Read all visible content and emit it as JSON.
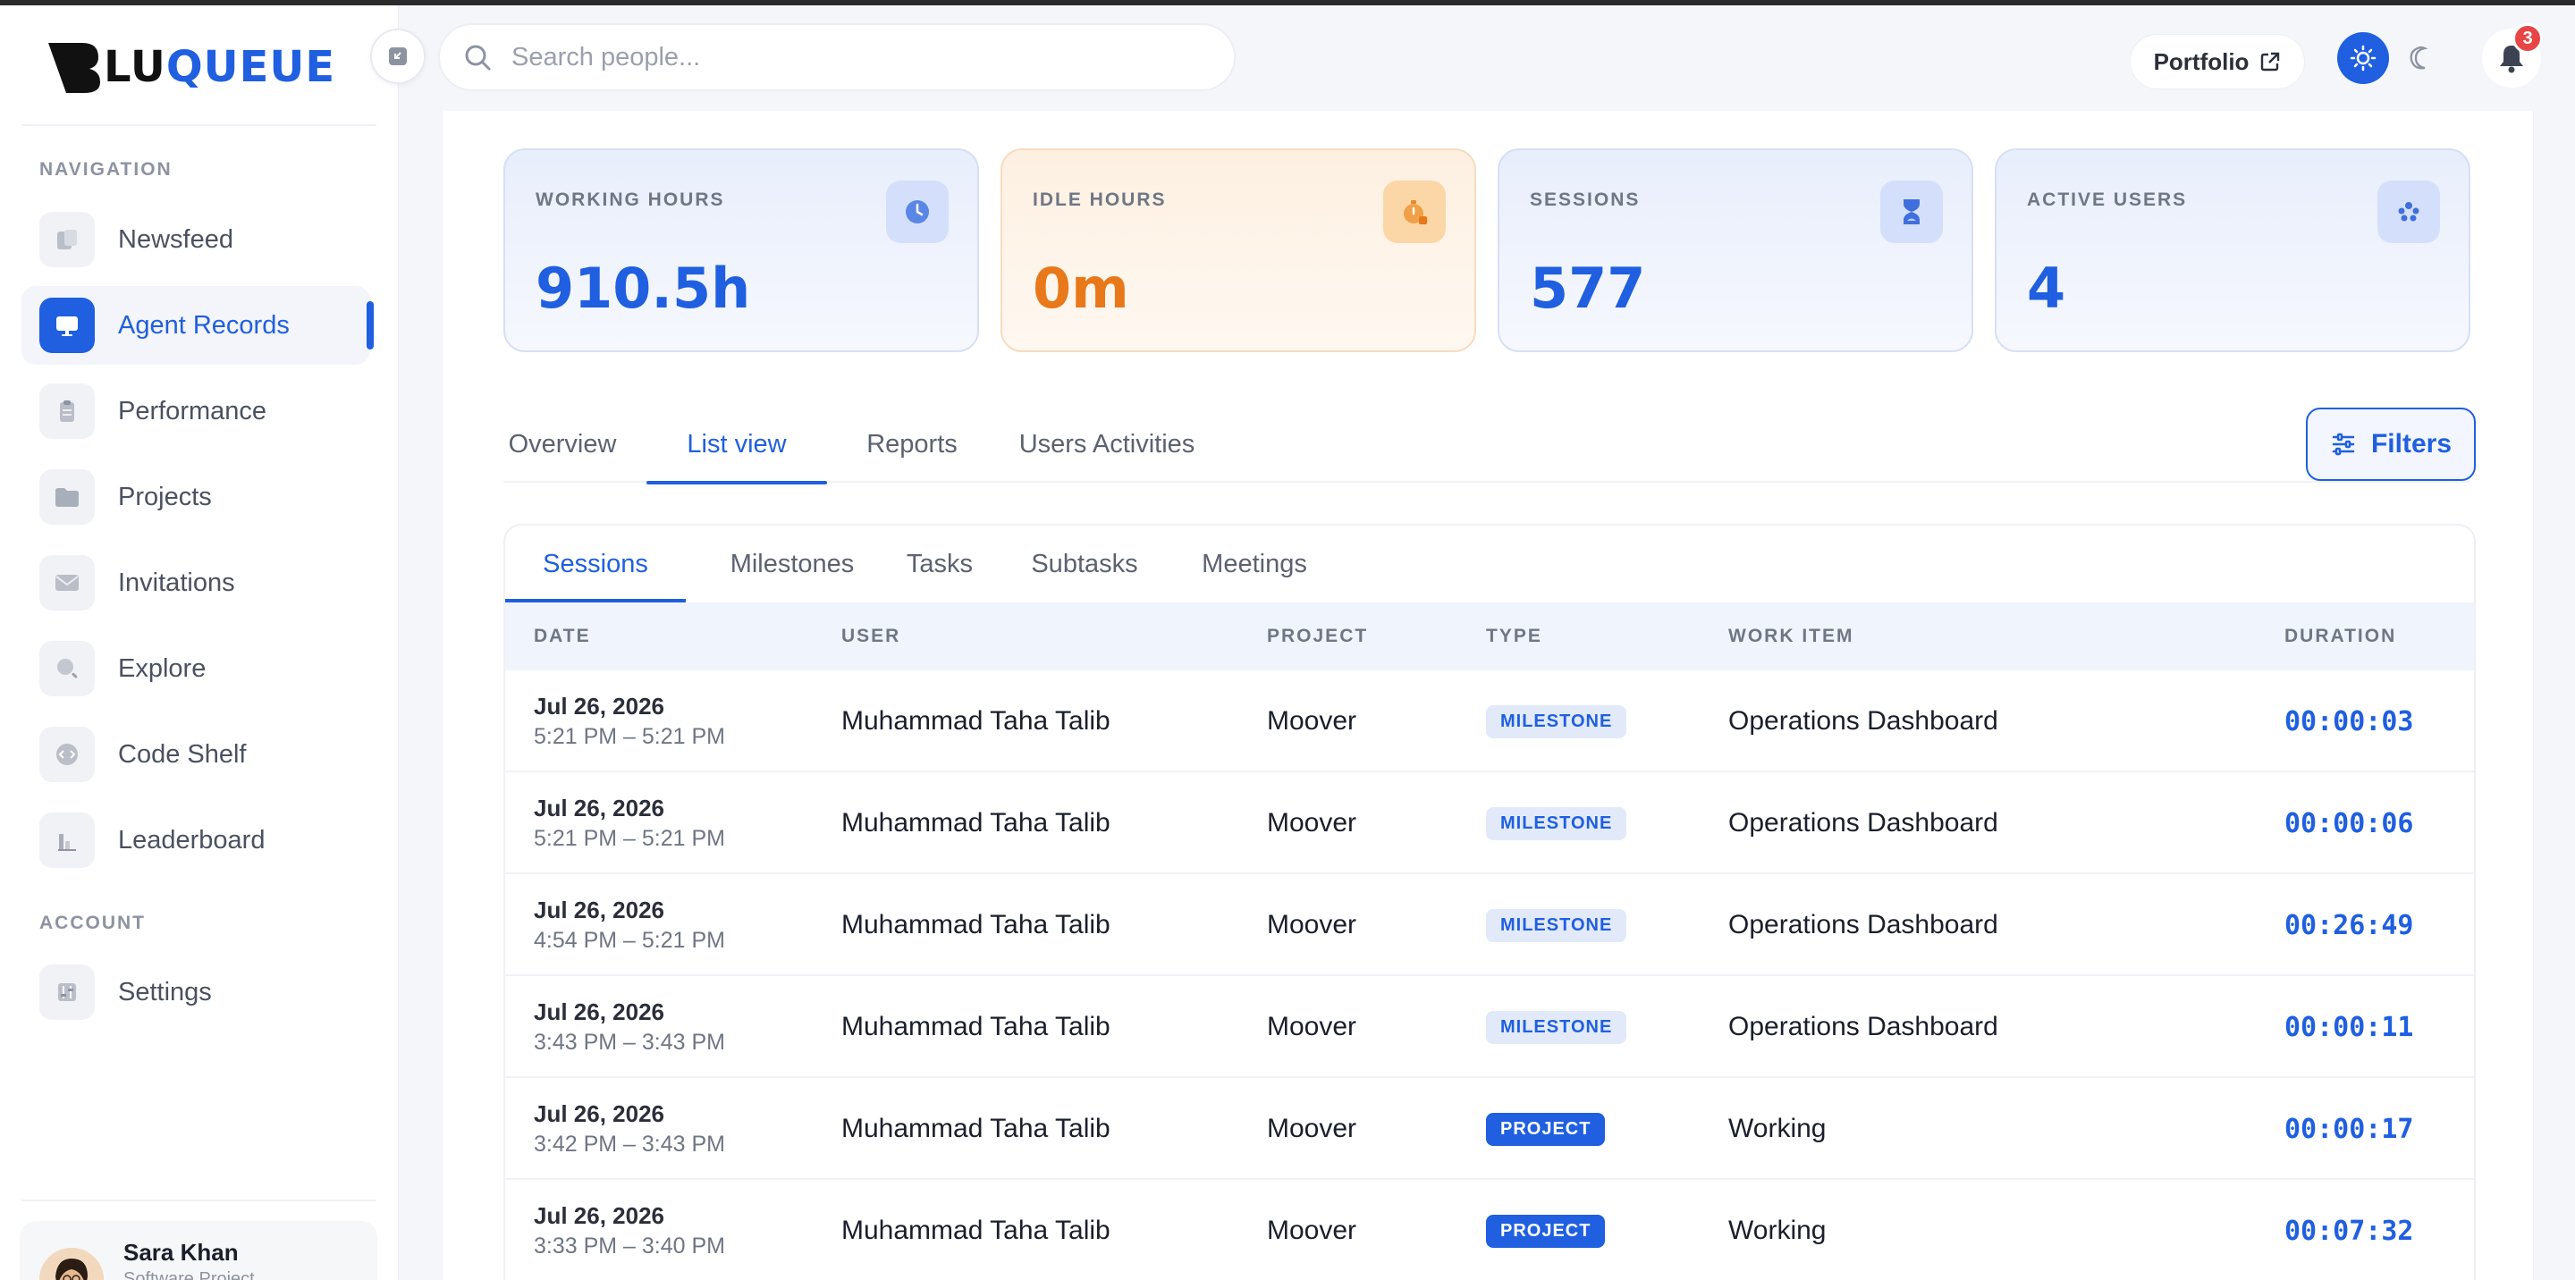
{
  "app": {
    "logo_part1": "LU",
    "logo_part2": "QUEUE",
    "accent_color": "#1f5fe0"
  },
  "search": {
    "placeholder": "Search people..."
  },
  "header": {
    "portfolio_label": "Portfolio",
    "notifications_count": "3"
  },
  "sidebar": {
    "nav_title": "NAVIGATION",
    "account_title": "ACCOUNT",
    "items": [
      {
        "label": "Newsfeed",
        "icon": "newsfeed-icon"
      },
      {
        "label": "Agent Records",
        "icon": "monitor-icon",
        "active": true
      },
      {
        "label": "Performance",
        "icon": "clipboard-icon"
      },
      {
        "label": "Projects",
        "icon": "folder-icon"
      },
      {
        "label": "Invitations",
        "icon": "envelope-icon"
      },
      {
        "label": "Explore",
        "icon": "search-icon"
      },
      {
        "label": "Code Shelf",
        "icon": "code-icon"
      },
      {
        "label": "Leaderboard",
        "icon": "bar-chart-icon"
      }
    ],
    "account_items": [
      {
        "label": "Settings",
        "icon": "sliders-icon"
      }
    ],
    "profile": {
      "name": "Sara Khan",
      "subtitle": "Software Project"
    }
  },
  "stats": [
    {
      "label": "WORKING HOURS",
      "value": "910.5h",
      "icon": "clock-icon"
    },
    {
      "label": "IDLE HOURS",
      "value": "0m",
      "icon": "timer-icon"
    },
    {
      "label": "SESSIONS",
      "value": "577",
      "icon": "hourglass-icon"
    },
    {
      "label": "ACTIVE USERS",
      "value": "4",
      "icon": "users-icon"
    }
  ],
  "tabs": [
    "Overview",
    "List view",
    "Reports",
    "Users Activities"
  ],
  "active_tab": "List view",
  "filters_label": "Filters",
  "subtabs": [
    "Sessions",
    "Milestones",
    "Tasks",
    "Subtasks",
    "Meetings"
  ],
  "active_subtab": "Sessions",
  "table": {
    "columns": [
      "DATE",
      "USER",
      "PROJECT",
      "TYPE",
      "WORK ITEM",
      "DURATION"
    ],
    "rows": [
      {
        "date": "Jul 26, 2026",
        "time": "5:21 PM – 5:21 PM",
        "user": "Muhammad Taha Talib",
        "project": "Moover",
        "type": "MILESTONE",
        "work_item": "Operations Dashboard",
        "duration": "00:00:03"
      },
      {
        "date": "Jul 26, 2026",
        "time": "5:21 PM – 5:21 PM",
        "user": "Muhammad Taha Talib",
        "project": "Moover",
        "type": "MILESTONE",
        "work_item": "Operations Dashboard",
        "duration": "00:00:06"
      },
      {
        "date": "Jul 26, 2026",
        "time": "4:54 PM – 5:21 PM",
        "user": "Muhammad Taha Talib",
        "project": "Moover",
        "type": "MILESTONE",
        "work_item": "Operations Dashboard",
        "duration": "00:26:49"
      },
      {
        "date": "Jul 26, 2026",
        "time": "3:43 PM – 3:43 PM",
        "user": "Muhammad Taha Talib",
        "project": "Moover",
        "type": "MILESTONE",
        "work_item": "Operations Dashboard",
        "duration": "00:00:11"
      },
      {
        "date": "Jul 26, 2026",
        "time": "3:42 PM – 3:43 PM",
        "user": "Muhammad Taha Talib",
        "project": "Moover",
        "type": "PROJECT",
        "work_item": "Working",
        "duration": "00:00:17"
      },
      {
        "date": "Jul 26, 2026",
        "time": "3:33 PM – 3:40 PM",
        "user": "Muhammad Taha Talib",
        "project": "Moover",
        "type": "PROJECT",
        "work_item": "Working",
        "duration": "00:07:32"
      }
    ]
  }
}
